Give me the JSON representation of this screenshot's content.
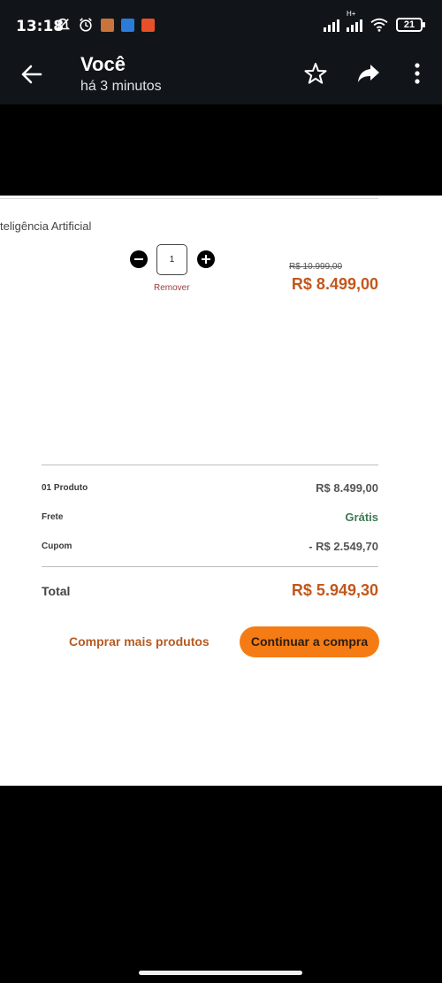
{
  "status_bar": {
    "time": "13:18",
    "network_label": "H+",
    "battery": "21"
  },
  "app_bar": {
    "title": "Você",
    "subtitle": "há 3 minutos"
  },
  "cart": {
    "product_name": "teligência Artificial",
    "quantity": "1",
    "remove_label": "Remover",
    "old_price": "R$ 10.999,00",
    "price": "R$ 8.499,00"
  },
  "summary": {
    "products_label": "01 Produto",
    "products_value": "R$ 8.499,00",
    "shipping_label": "Frete",
    "shipping_value": "Grátis",
    "coupon_label": "Cupom",
    "coupon_value": "- R$ 2.549,70",
    "total_label": "Total",
    "total_value": "R$ 5.949,30"
  },
  "actions": {
    "more_products": "Comprar mais produtos",
    "continue": "Continuar a compra"
  },
  "colors": {
    "accent_orange": "#f57c14",
    "price_orange": "#c2571c",
    "free_green": "#3d7a55",
    "bar_bg": "#111519"
  }
}
